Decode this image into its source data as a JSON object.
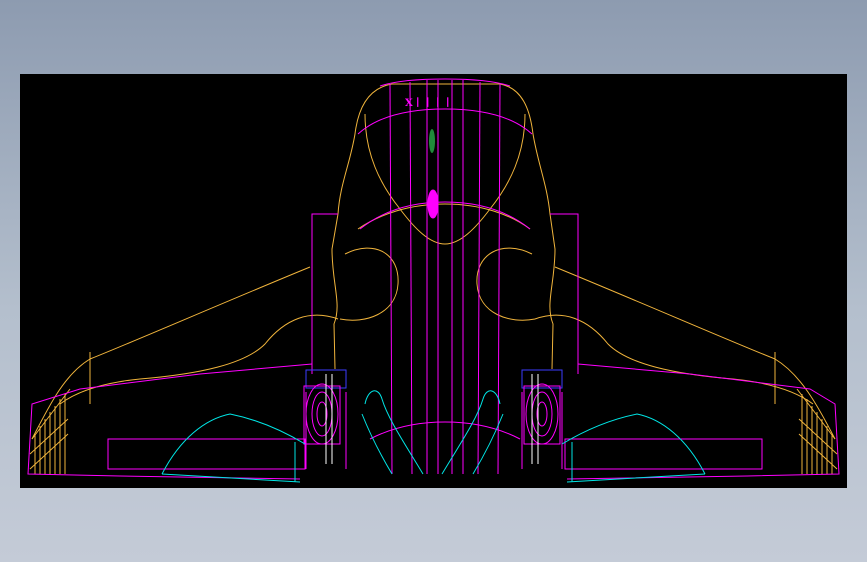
{
  "drawing": {
    "label_text": "X丨丨丨丨",
    "background": "#000000",
    "colors": {
      "outline": "#f0b43c",
      "structure": "#ff00ff",
      "flaps": "#00e5e5",
      "engine": "#3b3bff",
      "accent": "#ffffff",
      "marker": "#1f8a3a"
    }
  }
}
